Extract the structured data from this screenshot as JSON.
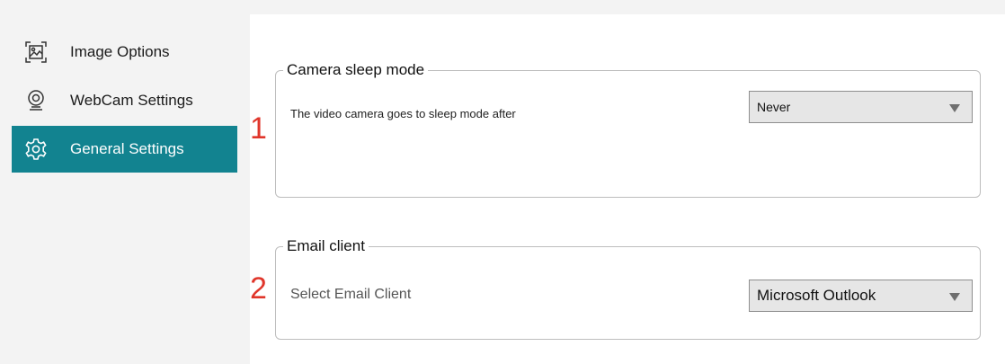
{
  "sidebar": {
    "items": [
      {
        "label": "Image Options",
        "icon": "image-icon",
        "active": false
      },
      {
        "label": "WebCam Settings",
        "icon": "webcam-icon",
        "active": false
      },
      {
        "label": "General Settings",
        "icon": "gear-icon",
        "active": true
      }
    ]
  },
  "camera_group": {
    "title": "Camera sleep mode",
    "label": "The video camera goes to sleep mode after",
    "select_value": "Never"
  },
  "email_group": {
    "title": "Email client",
    "label": "Select Email Client",
    "select_value": "Microsoft Outlook"
  },
  "markers": [
    "1",
    "2"
  ],
  "colors": {
    "accent": "#128390",
    "marker": "#e0362b",
    "sidebar_bg": "#f3f3f3",
    "panel_bg": "#ffffff"
  }
}
